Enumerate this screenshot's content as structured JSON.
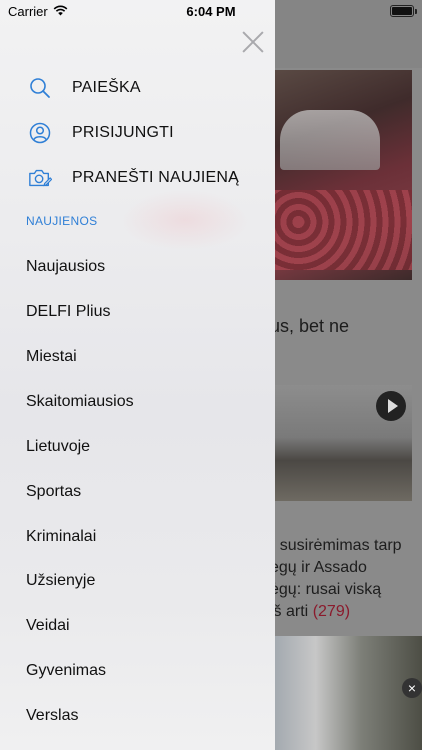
{
  "status_bar": {
    "carrier": "Carrier",
    "time": "6:04 PM",
    "icons": [
      "wifi-icon",
      "battery-icon"
    ]
  },
  "drawer": {
    "actions": [
      {
        "label": "PAIEŠKA",
        "icon": "search-icon"
      },
      {
        "label": "PRISIJUNGTI",
        "icon": "user-icon"
      },
      {
        "label": "PRANEŠTI NAUJIENĄ",
        "icon": "camera-icon"
      }
    ],
    "section_title": "NAUJIENOS",
    "menu": [
      "Naujausios",
      "DELFI Plius",
      "Miestai",
      "Skaitomiausios",
      "Lietuvoje",
      "Sportas",
      "Kriminalai",
      "Užsienyje",
      "Veidai",
      "Gyvenimas",
      "Verslas"
    ],
    "accent_color": "#2f7fd6"
  },
  "background": {
    "article1_fragment": "us, bet ne",
    "article2_lines": [
      "- susirėmimas tarp",
      "egų ir Assado",
      "ėgų: rusai viską",
      "iš arti"
    ],
    "article2_comments": "(279)"
  }
}
